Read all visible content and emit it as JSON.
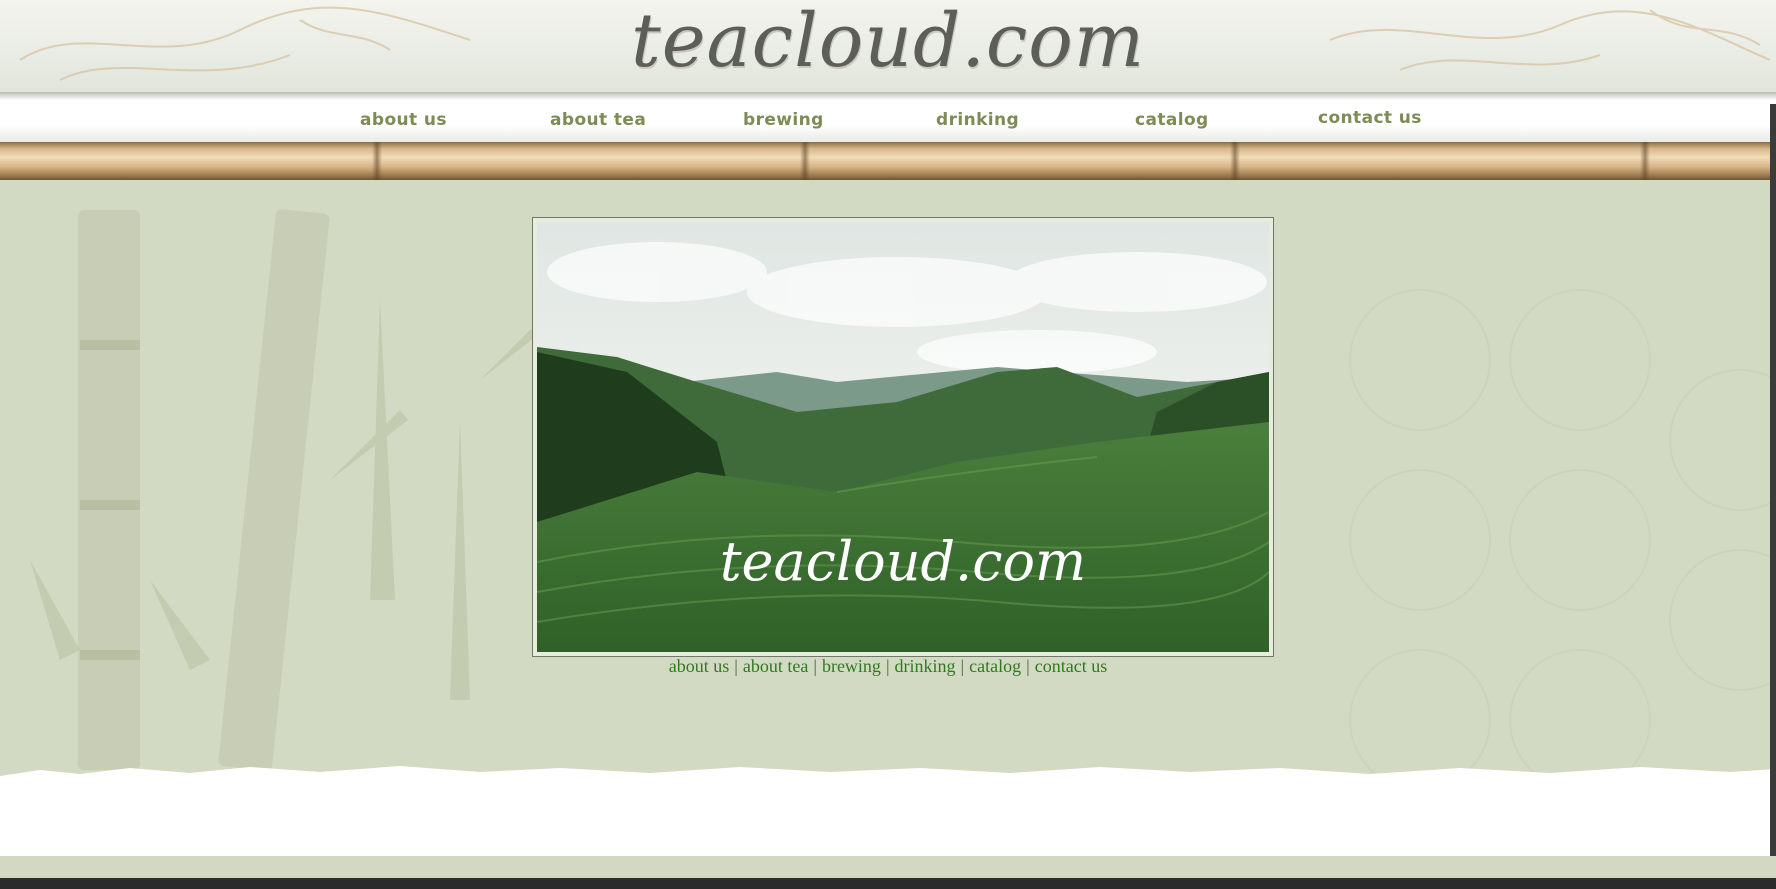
{
  "header": {
    "logo": "teacloud.com"
  },
  "nav": {
    "items": [
      {
        "label": "about us"
      },
      {
        "label": "about tea"
      },
      {
        "label": "brewing"
      },
      {
        "label": "drinking"
      },
      {
        "label": "catalog"
      },
      {
        "label": "contact us"
      }
    ]
  },
  "hero": {
    "caption": "teacloud.com"
  },
  "text_links": {
    "items": [
      "about us",
      "about tea",
      "brewing",
      "drinking",
      "catalog",
      "contact us"
    ],
    "separator": "|"
  },
  "colors": {
    "nav_text": "#7d8b55",
    "link_text": "#2f7a1f",
    "background": "#d3dac3"
  }
}
